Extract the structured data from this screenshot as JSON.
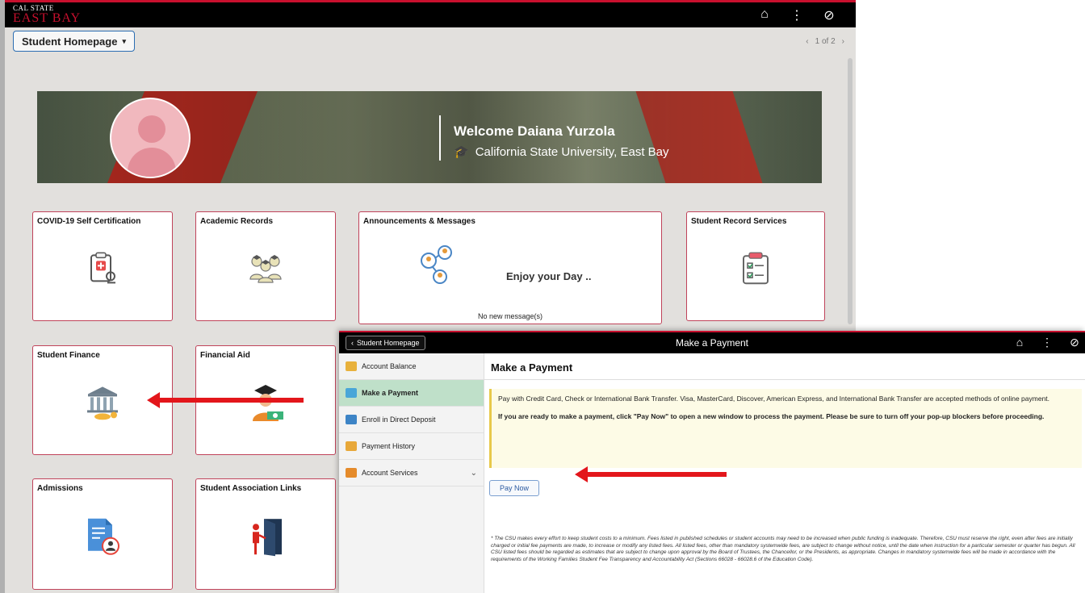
{
  "homepage": {
    "logo_small": "CAL STATE",
    "logo_big": "EAST BAY",
    "homepage_selector": "Student Homepage",
    "pager": "1 of 2",
    "welcome": "Welcome Daiana Yurzola",
    "campus": "California State University, East Bay",
    "tiles": [
      {
        "name": "COVID-19 Self Certification"
      },
      {
        "name": "Academic Records"
      },
      {
        "name": "Announcements & Messages",
        "message": "Enjoy your Day ..",
        "footer": "No new message(s)"
      },
      {
        "name": "Student Record Services"
      },
      {
        "name": "Student Finance"
      },
      {
        "name": "Financial Aid"
      },
      {
        "name": "Admissions"
      },
      {
        "name": "Student Association Links"
      }
    ]
  },
  "payment": {
    "back_label": "Student Homepage",
    "title": "Make a Payment",
    "sidebar": [
      {
        "label": "Account Balance",
        "color": "#e8b13c"
      },
      {
        "label": "Make a Payment",
        "color": "#49a6d8"
      },
      {
        "label": "Enroll in Direct Deposit",
        "color": "#3d84c6"
      },
      {
        "label": "Payment History",
        "color": "#e8a83a"
      },
      {
        "label": "Account Services",
        "color": "#e58b2b"
      }
    ],
    "heading": "Make a Payment",
    "notice_line1": "Pay with Credit Card, Check or International Bank Transfer. Visa, MasterCard, Discover, American Express, and International Bank Transfer are accepted methods of online payment.",
    "notice_line2": "If you are ready to make a payment, click \"Pay Now\" to open a new window to process the payment. Please be sure to turn off your pop-up blockers before proceeding.",
    "pay_now": "Pay Now",
    "disclaimer": "* The CSU makes every effort to keep student costs to a minimum. Fees listed in published schedules or student accounts may need to be increased when public funding is inadequate. Therefore, CSU must reserve the right, even after fees are initially charged or initial fee payments are made, to increase or modify any listed fees. All listed fees, other than mandatory systemwide fees, are subject to change without notice, until the date when instruction for a particular semester or quarter has begun. All CSU listed fees should be regarded as estimates that are subject to change upon approval by the Board of Trustees, the Chancellor, or the Presidents, as appropriate. Changes in mandatory systemwide fees will be made in accordance with the requirements of the Working Families Student Fee Transparency and Accountability Act (Sections 66028 - 66028.6 of the Education Code)."
  },
  "colors": {
    "brand_red": "#c8102e",
    "arrow_red": "#e3161b",
    "active_side": "#bfe0c9"
  }
}
